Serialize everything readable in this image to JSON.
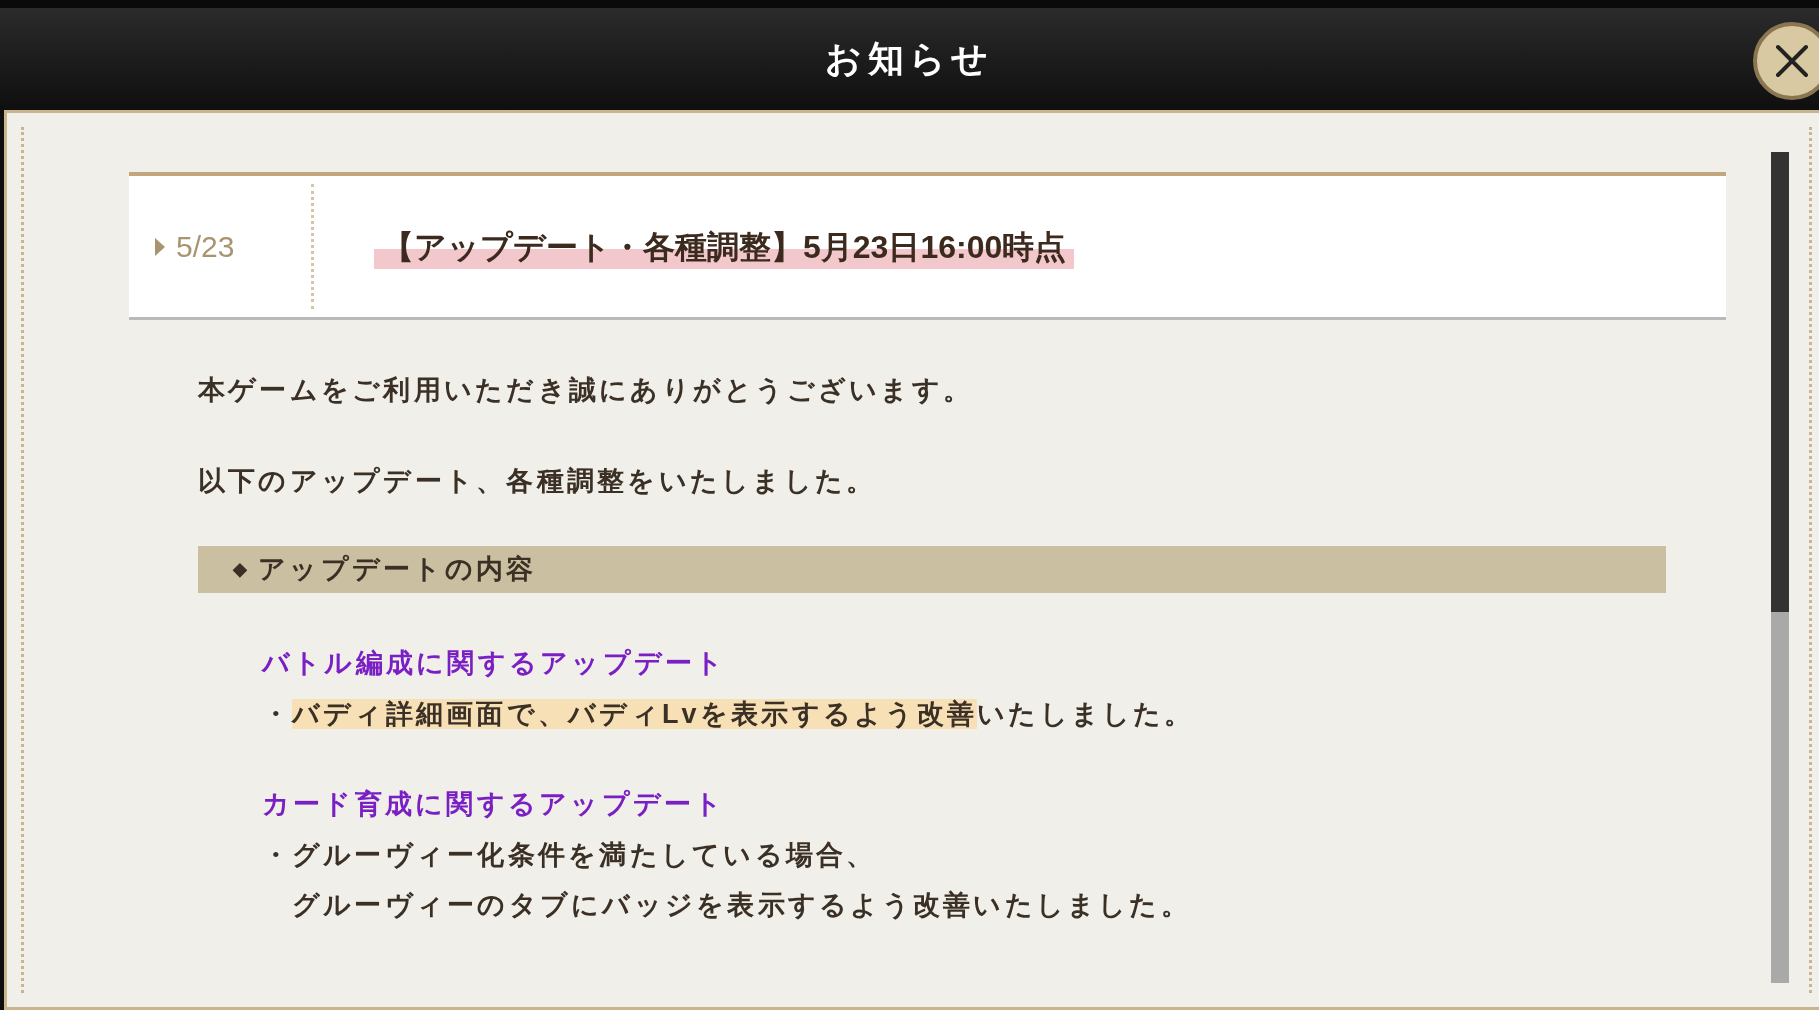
{
  "window": {
    "title": "お知らせ"
  },
  "notice": {
    "date": "5/23",
    "title": "【アップデート・各種調整】5月23日16:00時点",
    "title_highlighted": true
  },
  "paragraphs": [
    "本ゲームをご利用いただき誠にありがとうございます。",
    "以下のアップデート、各種調整をいたしました。"
  ],
  "section": {
    "marker": "◆",
    "title": "アップデートの内容"
  },
  "updates": [
    {
      "heading": "バトル編成に関するアップデート",
      "bullet": "・",
      "lines": [
        [
          {
            "text": "バディ詳細画面で、バディLvを表示するよう改善",
            "highlighted": true
          },
          {
            "text": "いたしました。",
            "highlighted": false
          }
        ]
      ]
    },
    {
      "heading": "カード育成に関するアップデート",
      "bullet": "・",
      "lines": [
        [
          {
            "text": "グルーヴィー化条件を満たしている場合、",
            "highlighted": false
          }
        ],
        [
          {
            "text": "グルーヴィーのタブにバッジを表示するよう改善いたしました。",
            "highlighted": false
          }
        ]
      ]
    }
  ]
}
